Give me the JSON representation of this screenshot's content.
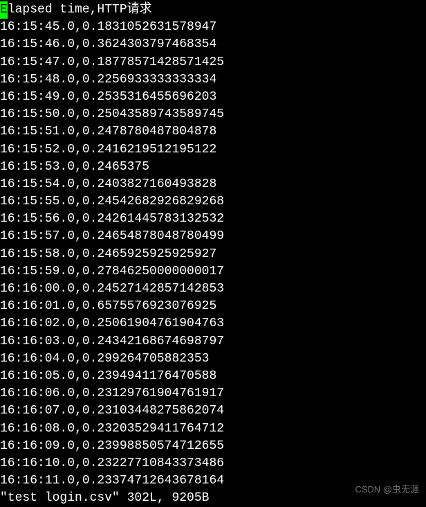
{
  "header": {
    "first_char": "E",
    "rest": "lapsed time,HTTP请求"
  },
  "rows": [
    "16:15:45.0,0.1831052631578947",
    "16:15:46.0,0.3624303797468354",
    "16:15:47.0,0.18778571428571425",
    "16:15:48.0,0.2256933333333334",
    "16:15:49.0,0.2535316455696203",
    "16:15:50.0,0.25043589743589745",
    "16:15:51.0,0.2478780487804878",
    "16:15:52.0,0.2416219512195122",
    "16:15:53.0,0.2465375",
    "16:15:54.0,0.2403827160493828",
    "16:15:55.0,0.24542682926829268",
    "16:15:56.0,0.24261445783132532",
    "16:15:57.0,0.24654878048780499",
    "16:15:58.0,0.2465925925925927",
    "16:15:59.0,0.27846250000000017",
    "16:16:00.0,0.24527142857142853",
    "16:16:01.0,0.6575576923076925",
    "16:16:02.0,0.25061904761904763",
    "16:16:03.0,0.24342168674698797",
    "16:16:04.0,0.299264705882353",
    "16:16:05.0,0.2394941176470588",
    "16:16:06.0,0.23129761904761917",
    "16:16:07.0,0.23103448275862074",
    "16:16:08.0,0.23203529411764712",
    "16:16:09.0,0.23998850574712655",
    "16:16:10.0,0.23227710843373486",
    "16:16:11.0,0.23374712643678164"
  ],
  "status_line": "\"test login.csv\" 302L, 9205B",
  "watermark": "CSDN @虫无涯"
}
